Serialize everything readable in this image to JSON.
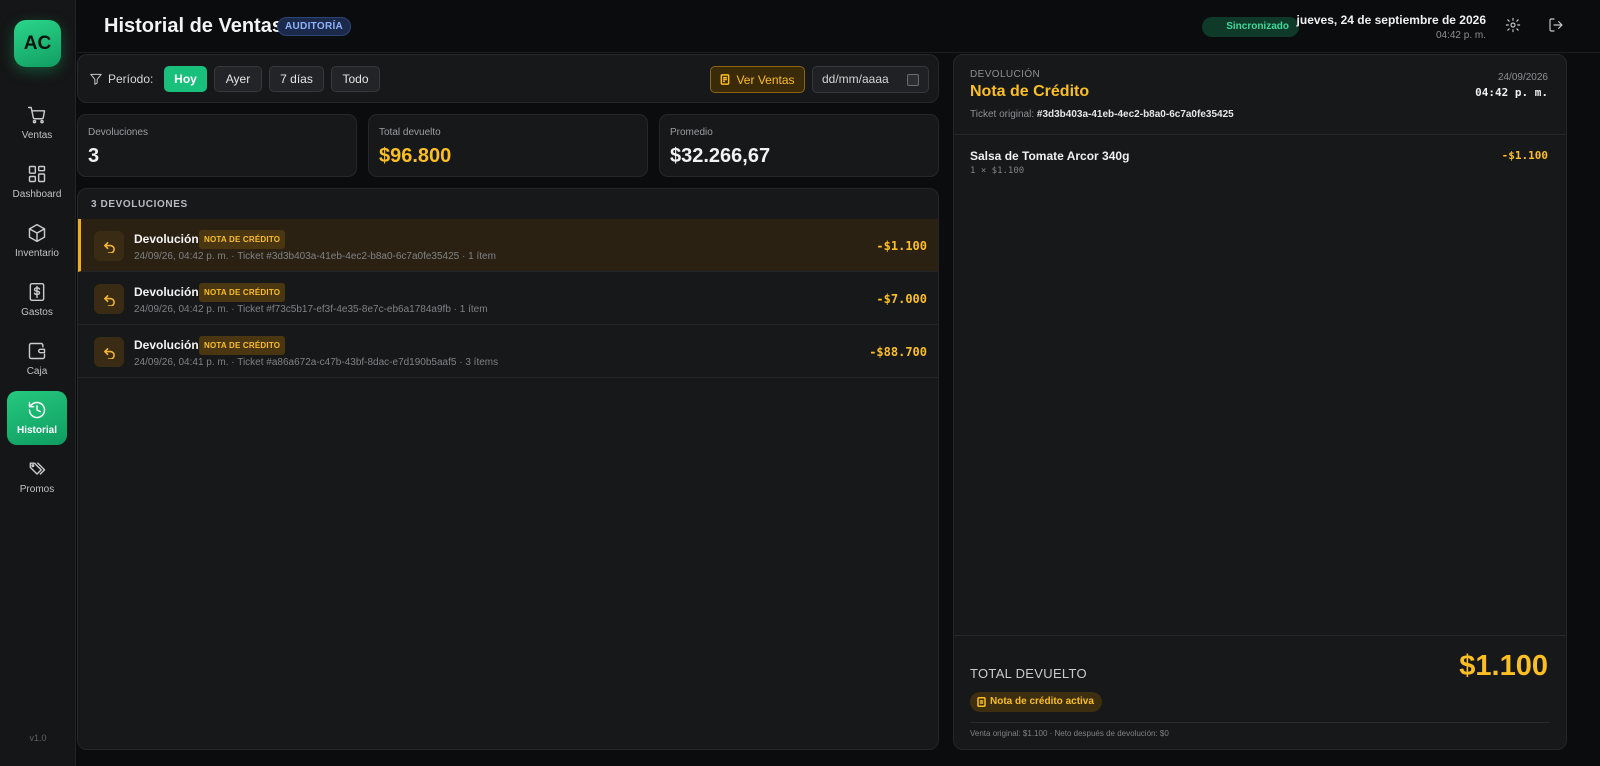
{
  "sidebar": {
    "logo": "AC",
    "items": [
      {
        "label": "Ventas",
        "icon": "cart-icon"
      },
      {
        "label": "Dashboard",
        "icon": "grid-icon"
      },
      {
        "label": "Inventario",
        "icon": "box-icon"
      },
      {
        "label": "Gastos",
        "icon": "dollar-receipt-icon"
      },
      {
        "label": "Caja",
        "icon": "wallet-icon"
      },
      {
        "label": "Historial",
        "icon": "history-icon",
        "active": true
      },
      {
        "label": "Promos",
        "icon": "tags-icon"
      }
    ],
    "version": "v1.0"
  },
  "header": {
    "title": "Historial de Ventas",
    "badge": "AUDITORÍA",
    "sync_status": "Sincronizado",
    "date": "jueves, 24 de septiembre de 2026",
    "time": "04:42 p. m.",
    "icons": [
      "gear-icon",
      "logout-icon"
    ]
  },
  "filters": {
    "label": "Período:",
    "options": [
      "Hoy",
      "Ayer",
      "7 días",
      "Todo"
    ],
    "active": "Hoy",
    "ver_ventas": "Ver Ventas",
    "date_placeholder": "dd/mm/aaaa"
  },
  "stats": [
    {
      "label": "Devoluciones",
      "value": "3"
    },
    {
      "label": "Total devuelto",
      "value": "$96.800"
    },
    {
      "label": "Promedio",
      "value": "$32.266,67"
    }
  ],
  "list": {
    "header": "3 DEVOLUCIONES",
    "rows": [
      {
        "title": "Devolución",
        "badge": "NOTA DE CRÉDITO",
        "subtitle": "24/09/26, 04:42 p. m. · Ticket #3d3b403a-41eb-4ec2-b8a0-6c7a0fe35425 · 1 ítem",
        "amount": "-$1.100",
        "selected": true
      },
      {
        "title": "Devolución",
        "badge": "NOTA DE CRÉDITO",
        "subtitle": "24/09/26, 04:42 p. m. · Ticket #f73c5b17-ef3f-4e35-8e7c-eb6a1784a9fb · 1 ítem",
        "amount": "-$7.000"
      },
      {
        "title": "Devolución",
        "badge": "NOTA DE CRÉDITO",
        "subtitle": "24/09/26, 04:41 p. m. · Ticket #a86a672a-c47b-43bf-8dac-e7d190b5aaf5 · 3 ítems",
        "amount": "-$88.700"
      }
    ]
  },
  "detail": {
    "kicker": "DEVOLUCIÓN",
    "title": "Nota de Crédito",
    "ticket_label": "Ticket original:",
    "ticket_id": "#3d3b403a-41eb-4ec2-b8a0-6c7a0fe35425",
    "date": "24/09/2026",
    "time": "04:42 p. m.",
    "items": [
      {
        "name": "Salsa de Tomate Arcor 340g",
        "qty": "1 × $1.100",
        "amount": "-$1.100"
      }
    ],
    "total_label": "TOTAL DEVUELTO",
    "total_value": "$1.100",
    "status_badge": "Nota de crédito activa",
    "footnote": "Venta original: $1.100 · Neto después de devolución: $0"
  },
  "colors": {
    "accent_green": "#19c07c",
    "accent_gold": "#fbbf24",
    "background": "#0b0c0d",
    "panel": "#17181a"
  }
}
